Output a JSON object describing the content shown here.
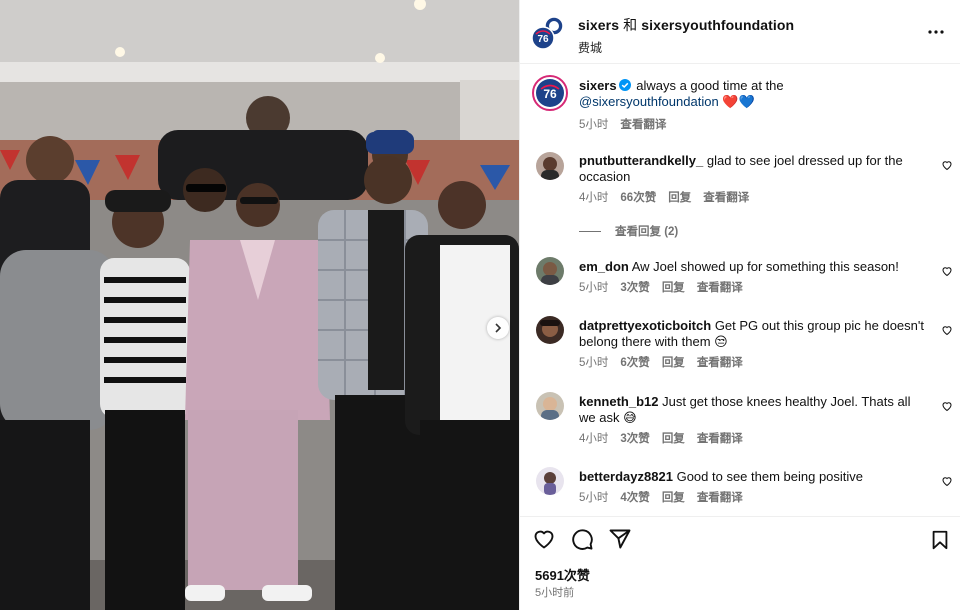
{
  "header": {
    "account": "sixers",
    "joiner": "和",
    "collaborator": "sixersyouthfoundation",
    "location": "费城"
  },
  "caption": {
    "user": "sixers",
    "text_pre": "always a good time at the ",
    "mention": "@sixersyouthfoundation",
    "emoji": "❤️💙",
    "time": "5小时",
    "translate": "查看翻译"
  },
  "comments": [
    {
      "user": "pnutbutterandkelly_",
      "text": "glad to see joel dressed up for the occasion",
      "time": "4小时",
      "likes": "66次赞",
      "reply": "回复",
      "translate": "查看翻译",
      "view_replies": "查看回复 (2)"
    },
    {
      "user": "em_don",
      "text": "Aw Joel showed up for something this season!",
      "time": "5小时",
      "likes": "3次赞",
      "reply": "回复",
      "translate": "查看翻译"
    },
    {
      "user": "datprettyexoticboitch",
      "text": "Get PG out this group pic he doesn't belong there with them 😒",
      "time": "5小时",
      "likes": "6次赞",
      "reply": "回复",
      "translate": "查看翻译"
    },
    {
      "user": "kenneth_b12",
      "text": "Just get those knees healthy Joel. Thats all we ask 😅",
      "time": "4小时",
      "likes": "3次赞",
      "reply": "回复",
      "translate": "查看翻译"
    },
    {
      "user": "betterdayz8821",
      "text": "Good to see them being positive",
      "time": "5小时",
      "likes": "4次赞",
      "reply": "回复",
      "translate": "查看翻译"
    }
  ],
  "footer": {
    "likes": "5691次赞",
    "time_ago": "5小时前"
  },
  "colors": {
    "accent_link": "#00376b",
    "muted": "#737373",
    "sixers_blue": "#1d428a",
    "sixers_red": "#ed174c",
    "verified": "#0095f6"
  },
  "icons": [
    "more-icon",
    "next-arrow-icon",
    "heart-icon",
    "comment-icon",
    "share-icon",
    "bookmark-icon",
    "verified-badge-icon"
  ]
}
